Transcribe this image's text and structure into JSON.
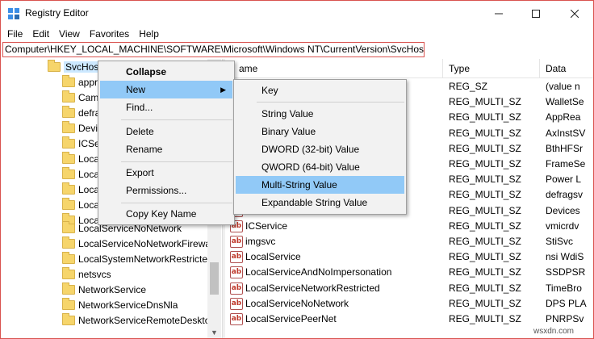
{
  "window": {
    "title": "Registry Editor"
  },
  "menubar": {
    "items": [
      "File",
      "Edit",
      "View",
      "Favorites",
      "Help"
    ]
  },
  "address": "Computer\\HKEY_LOCAL_MACHINE\\SOFTWARE\\Microsoft\\Windows NT\\CurrentVersion\\SvcHost",
  "tree": {
    "selected": "SvcHost",
    "items": [
      "appr",
      "Cam",
      "defra",
      "Devi",
      "ICSe",
      "Local",
      "Local",
      "Local",
      "Local",
      "Local",
      "LocalServiceNoNetwork",
      "LocalServiceNoNetworkFirewa",
      "LocalSystemNetworkRestricted",
      "netsvcs",
      "NetworkService",
      "NetworkServiceDnsNla",
      "NetworkServiceRemoteDeskto"
    ]
  },
  "list": {
    "columns": {
      "name": "Name",
      "name_visible": "ame",
      "type": "Type",
      "data": "Data"
    },
    "rows": [
      {
        "name": "",
        "type": "REG_SZ",
        "data": "(value n"
      },
      {
        "name": "",
        "type": "REG_MULTI_SZ",
        "data": "WalletSe"
      },
      {
        "name": "",
        "type": "REG_MULTI_SZ",
        "data": "AppRea"
      },
      {
        "name": "",
        "type": "REG_MULTI_SZ",
        "data": "AxInstSV"
      },
      {
        "name": "",
        "type": "REG_MULTI_SZ",
        "data": "BthHFSr"
      },
      {
        "name": "",
        "type": "REG_MULTI_SZ",
        "data": "FrameSe"
      },
      {
        "name": "",
        "type": "REG_MULTI_SZ",
        "data": "Power L"
      },
      {
        "name": "",
        "type": "REG_MULTI_SZ",
        "data": "defragsv"
      },
      {
        "name": "",
        "type": "REG_MULTI_SZ",
        "data": "Devices"
      },
      {
        "name": "ICService",
        "type": "REG_MULTI_SZ",
        "data": "vmicrdv"
      },
      {
        "name": "imgsvc",
        "type": "REG_MULTI_SZ",
        "data": "StiSvc"
      },
      {
        "name": "LocalService",
        "type": "REG_MULTI_SZ",
        "data": "nsi WdiS"
      },
      {
        "name": "LocalServiceAndNoImpersonation",
        "type": "REG_MULTI_SZ",
        "data": "SSDPSR"
      },
      {
        "name": "LocalServiceNetworkRestricted",
        "type": "REG_MULTI_SZ",
        "data": "TimeBro"
      },
      {
        "name": "LocalServiceNoNetwork",
        "type": "REG_MULTI_SZ",
        "data": "DPS PLA"
      },
      {
        "name": "LocalServicePeerNet",
        "type": "REG_MULTI_SZ",
        "data": "PNRPSv"
      }
    ],
    "value_icon_label": "ab"
  },
  "context_menu": {
    "items": [
      "Collapse",
      "New",
      "Find...",
      "Delete",
      "Rename",
      "Export",
      "Permissions...",
      "Copy Key Name"
    ],
    "highlighted": "New"
  },
  "submenu": {
    "items": [
      "Key",
      "String Value",
      "Binary Value",
      "DWORD (32-bit) Value",
      "QWORD (64-bit) Value",
      "Multi-String Value",
      "Expandable String Value"
    ],
    "highlighted": "Multi-String Value"
  },
  "watermark": "wsxdn.com",
  "colors": {
    "highlight": "#91c9f7",
    "selection": "#cce8ff",
    "accent_border": "#d9534f"
  },
  "icons": [
    "registry-app-icon",
    "folder-icon",
    "string-value-icon",
    "minimize-icon",
    "maximize-icon",
    "close-icon",
    "submenu-arrow-icon"
  ]
}
